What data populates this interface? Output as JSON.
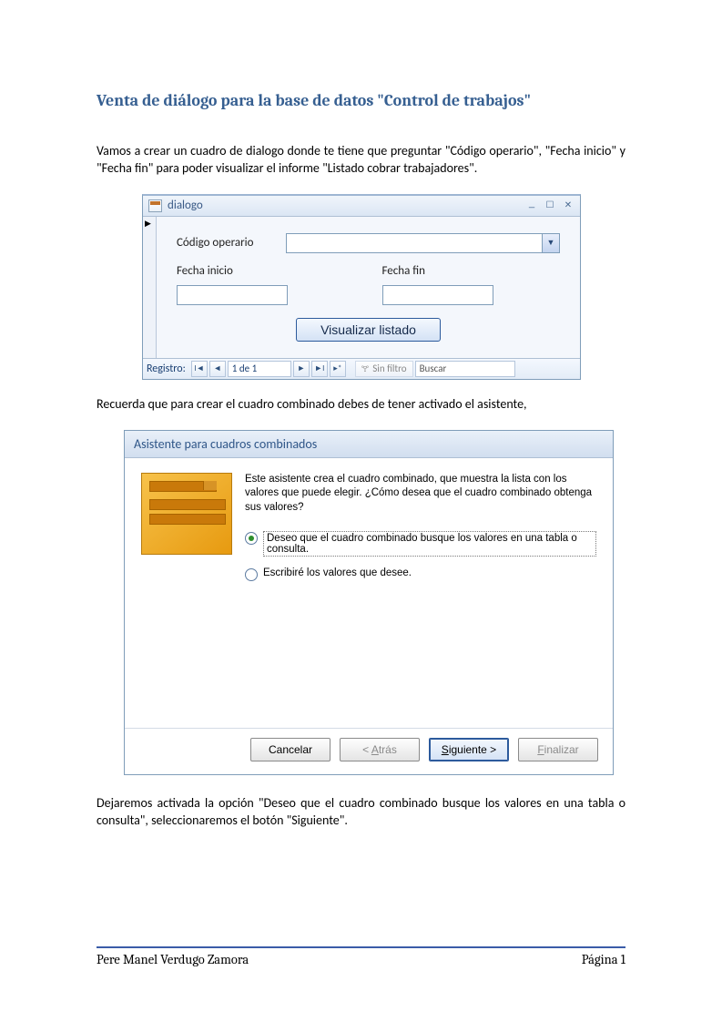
{
  "doc": {
    "title": "Venta de diálogo para la base de datos \"Control de trabajos\"",
    "intro": "Vamos a crear un cuadro de dialogo donde te tiene que preguntar \"Código operario\", \"Fecha inicio\" y \"Fecha fin\" para poder visualizar el informe \"Listado cobrar trabajadores\".",
    "mid": "Recuerda que para crear el cuadro combinado debes de tener activado el asistente,",
    "outro": "Dejaremos activada la opción \"Deseo que el cuadro combinado busque los valores en una tabla o consulta\", seleccionaremos el botón \"Siguiente\"."
  },
  "form": {
    "window_title": "dialogo",
    "labels": {
      "codigo": "Código operario",
      "fecha_inicio": "Fecha inicio",
      "fecha_fin": "Fecha fin"
    },
    "button": "Visualizar listado",
    "record_nav": {
      "label": "Registro:",
      "pos": "1 de 1",
      "filter": "Sin filtro",
      "search": "Buscar"
    }
  },
  "wizard": {
    "title": "Asistente para cuadros combinados",
    "intro": "Este asistente crea el cuadro combinado, que muestra la lista con los valores que puede elegir. ¿Cómo desea que el cuadro combinado obtenga sus valores?",
    "option1": "Deseo que el cuadro combinado busque los valores en una tabla o consulta.",
    "option2": "Escribiré los valores que desee.",
    "buttons": {
      "cancel": "Cancelar",
      "back": "< Atrás",
      "next": "Siguiente >",
      "finish": "Finalizar"
    }
  },
  "footer": {
    "author": "Pere Manel Verdugo Zamora",
    "page": "Página 1"
  }
}
